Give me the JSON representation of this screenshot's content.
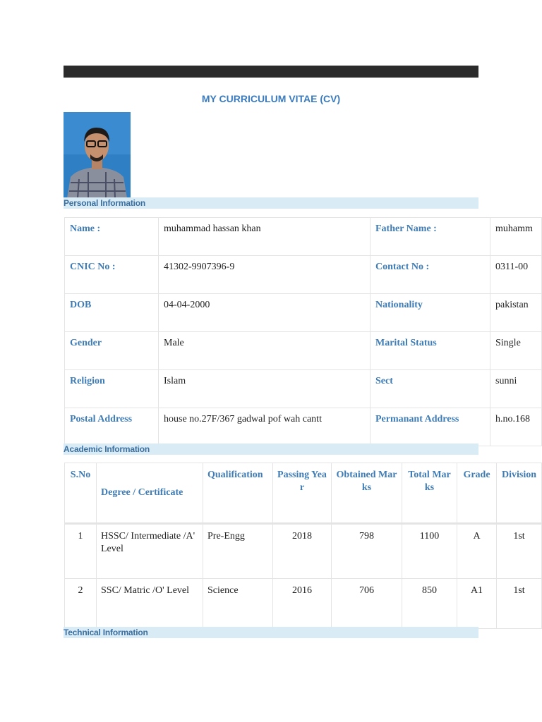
{
  "title": "MY CURRICULUM VITAE (CV)",
  "sections": {
    "personal": "Personal Information",
    "academic": "Academic Information",
    "technical": "Technical Information"
  },
  "personal": [
    {
      "l1": "Name :",
      "v1": "muhammad hassan khan",
      "l2": "Father Name :",
      "v2": "muhamm"
    },
    {
      "l1": "CNIC No :",
      "v1": "41302-9907396-9",
      "l2": "Contact No :",
      "v2": "0311-00"
    },
    {
      "l1": "DOB",
      "v1": "04-04-2000",
      "l2": "Nationality",
      "v2": "pakistan"
    },
    {
      "l1": "Gender",
      "v1": "Male",
      "l2": "Marital Status",
      "v2": "Single"
    },
    {
      "l1": "Religion",
      "v1": "Islam",
      "l2": "Sect",
      "v2": "sunni"
    },
    {
      "l1": "Postal Address",
      "v1": "house no.27F/367 gadwal pof wah cantt",
      "l2": "Permanant Address",
      "v2": "h.no.168"
    }
  ],
  "academic": {
    "headers": [
      "S.No",
      "Degree / Certificate",
      "Qualification",
      "Passing Year",
      "Obtained Marks",
      "Total Marks",
      "Grade",
      "Division"
    ],
    "rows": [
      [
        "1",
        "HSSC/ Intermediate /A' Level",
        "Pre-Engg",
        "2018",
        "798",
        "1100",
        "A",
        "1st"
      ],
      [
        "2",
        "SSC/ Matric /O' Level",
        "Science",
        "2016",
        "706",
        "850",
        "A1",
        "1st"
      ]
    ]
  }
}
